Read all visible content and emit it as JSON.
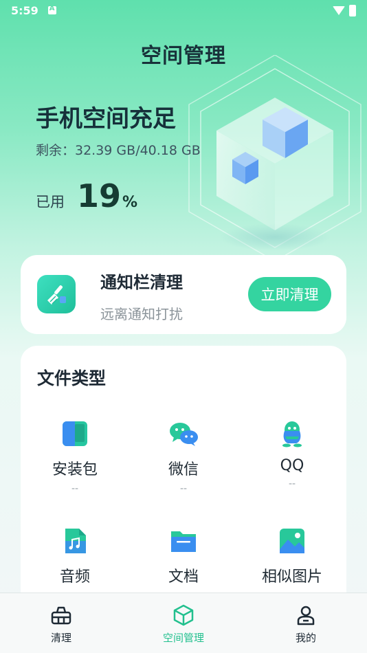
{
  "status_bar": {
    "time": "5:59"
  },
  "header": {
    "title": "空间管理"
  },
  "storage": {
    "status": "手机空间充足",
    "remaining_label": "剩余：32.39 GB/40.18 GB",
    "used_label": "已用",
    "used_percent": "19",
    "used_unit": "%"
  },
  "notify_card": {
    "title": "通知栏清理",
    "subtitle": "远离通知打扰",
    "button_label": "立即清理"
  },
  "file_types": {
    "title": "文件类型",
    "items": [
      {
        "name": "安装包",
        "size": "--",
        "icon": "apk-icon"
      },
      {
        "name": "微信",
        "size": "--",
        "icon": "wechat-icon"
      },
      {
        "name": "QQ",
        "size": "--",
        "icon": "qq-icon"
      },
      {
        "name": "音频",
        "icon": "audio-file-icon"
      },
      {
        "name": "文档",
        "icon": "folder-icon"
      },
      {
        "name": "相似图片",
        "icon": "image-icon"
      }
    ]
  },
  "bottom_nav": {
    "items": [
      {
        "label": "清理",
        "icon": "basket-icon",
        "active": false
      },
      {
        "label": "空间管理",
        "icon": "cube-icon",
        "active": true
      },
      {
        "label": "我的",
        "icon": "user-icon",
        "active": false
      }
    ]
  },
  "colors": {
    "accent": "#34d4a0",
    "active_nav": "#22c08e"
  }
}
